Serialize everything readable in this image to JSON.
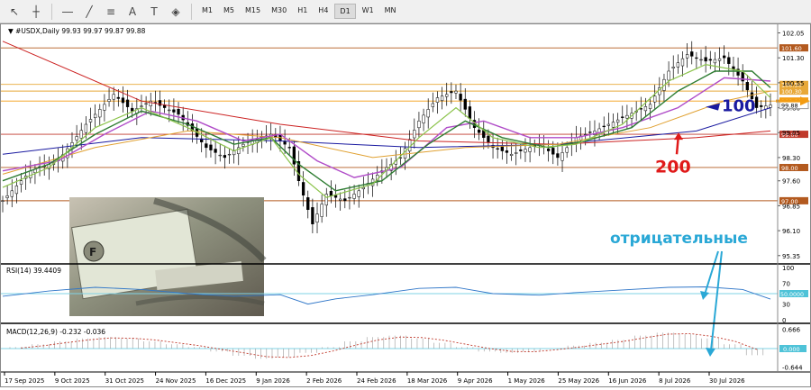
{
  "toolbar": {
    "tools": [
      "cursor-icon",
      "crosshair-icon",
      "horizontal-line-icon",
      "trendline-icon",
      "fibonacci-icon",
      "text-icon",
      "label-icon",
      "shapes-icon"
    ],
    "timeframes": [
      "M1",
      "M5",
      "M15",
      "M30",
      "H1",
      "H4",
      "D1",
      "W1",
      "MN"
    ],
    "active_timeframe": "D1"
  },
  "chart_data": {
    "type": "line",
    "header": "▼ #USDX,Daily  99.93 99.97 99.87 99.88",
    "price_ticks": [
      "102.05",
      "101.30",
      "100.55",
      "99.80",
      "99.05",
      "98.30",
      "97.60",
      "96.85",
      "96.10",
      "95.35"
    ],
    "hlines": [
      {
        "label": "101.60",
        "value": 101.6,
        "color": "#b35a1f"
      },
      {
        "label": "100.50",
        "value": 100.5,
        "color": "#e8a838"
      },
      {
        "label": "100.30",
        "value": 100.3,
        "color": "#e8a838"
      },
      {
        "label": "100.00",
        "value": 100.0,
        "color": "#f39c12"
      },
      {
        "label": "99.00",
        "value": 99.0,
        "color": "#c0392b"
      },
      {
        "label": "98.00",
        "value": 98.0,
        "color": "#b35a1f"
      },
      {
        "label": "97.00",
        "value": 97.0,
        "color": "#b35a1f"
      }
    ],
    "current_price_label": "99.88",
    "annotations": {
      "ma100": "100",
      "ma200": "200",
      "negative": "отрицательные"
    },
    "x_labels": [
      "17 Sep 2025",
      "9 Oct 2025",
      "31 Oct 2025",
      "24 Nov 2025",
      "16 Dec 2025",
      "9 Jan 2026",
      "2 Feb 2026",
      "24 Feb 2026",
      "18 Mar 2026",
      "9 Apr 2026",
      "1 May 2026",
      "25 May 2026",
      "16 Jun 2026",
      "8 Jul 2026",
      "30 Jul 2026"
    ],
    "close_path": [
      [
        0,
        97.0
      ],
      [
        6,
        97.9
      ],
      [
        12,
        98.2
      ],
      [
        18,
        99.3
      ],
      [
        24,
        100.2
      ],
      [
        28,
        99.7
      ],
      [
        32,
        100.0
      ],
      [
        38,
        99.6
      ],
      [
        44,
        98.6
      ],
      [
        48,
        98.3
      ],
      [
        52,
        98.7
      ],
      [
        58,
        99.0
      ],
      [
        62,
        98.6
      ],
      [
        64,
        97.6
      ],
      [
        67,
        96.3
      ],
      [
        70,
        97.2
      ],
      [
        74,
        97.0
      ],
      [
        78,
        97.4
      ],
      [
        82,
        97.9
      ],
      [
        86,
        98.3
      ],
      [
        90,
        99.4
      ],
      [
        94,
        100.1
      ],
      [
        98,
        100.3
      ],
      [
        102,
        99.2
      ],
      [
        106,
        98.6
      ],
      [
        110,
        98.4
      ],
      [
        116,
        98.7
      ],
      [
        120,
        98.3
      ],
      [
        124,
        98.9
      ],
      [
        128,
        99.1
      ],
      [
        134,
        99.5
      ],
      [
        140,
        99.9
      ],
      [
        144,
        100.9
      ],
      [
        148,
        101.4
      ],
      [
        152,
        101.2
      ],
      [
        156,
        101.3
      ],
      [
        160,
        100.6
      ],
      [
        163,
        99.8
      ],
      [
        166,
        99.88
      ]
    ],
    "ma_fast_path": [
      [
        0,
        97.4
      ],
      [
        10,
        98.0
      ],
      [
        20,
        99.2
      ],
      [
        30,
        99.8
      ],
      [
        40,
        99.2
      ],
      [
        50,
        98.5
      ],
      [
        58,
        98.9
      ],
      [
        64,
        97.8
      ],
      [
        70,
        97.1
      ],
      [
        80,
        97.5
      ],
      [
        90,
        98.9
      ],
      [
        98,
        99.8
      ],
      [
        106,
        98.9
      ],
      [
        116,
        98.6
      ],
      [
        124,
        98.7
      ],
      [
        134,
        99.3
      ],
      [
        144,
        100.6
      ],
      [
        152,
        101.1
      ],
      [
        160,
        100.9
      ],
      [
        166,
        100.1
      ]
    ],
    "ma_slow_path": [
      [
        0,
        97.6
      ],
      [
        10,
        98.1
      ],
      [
        20,
        99.0
      ],
      [
        30,
        99.7
      ],
      [
        40,
        99.3
      ],
      [
        50,
        98.7
      ],
      [
        58,
        98.9
      ],
      [
        64,
        98.1
      ],
      [
        72,
        97.3
      ],
      [
        82,
        97.6
      ],
      [
        92,
        98.7
      ],
      [
        100,
        99.4
      ],
      [
        108,
        98.9
      ],
      [
        118,
        98.6
      ],
      [
        126,
        98.8
      ],
      [
        136,
        99.2
      ],
      [
        146,
        100.3
      ],
      [
        154,
        100.9
      ],
      [
        162,
        100.9
      ],
      [
        166,
        100.4
      ]
    ],
    "ma_violet_path": [
      [
        0,
        97.9
      ],
      [
        12,
        98.2
      ],
      [
        22,
        99.0
      ],
      [
        32,
        99.7
      ],
      [
        42,
        99.4
      ],
      [
        52,
        98.8
      ],
      [
        60,
        99.0
      ],
      [
        68,
        98.2
      ],
      [
        76,
        97.7
      ],
      [
        86,
        98.0
      ],
      [
        96,
        99.2
      ],
      [
        104,
        99.4
      ],
      [
        114,
        98.9
      ],
      [
        124,
        98.9
      ],
      [
        134,
        99.2
      ],
      [
        146,
        99.8
      ],
      [
        156,
        100.7
      ],
      [
        166,
        100.6
      ]
    ],
    "ma100_path": [
      [
        0,
        98.4
      ],
      [
        30,
        98.9
      ],
      [
        60,
        98.8
      ],
      [
        90,
        98.6
      ],
      [
        120,
        98.7
      ],
      [
        150,
        99.1
      ],
      [
        166,
        99.8
      ]
    ],
    "ma200_path": [
      [
        0,
        101.8
      ],
      [
        30,
        100.0
      ],
      [
        60,
        99.3
      ],
      [
        90,
        98.8
      ],
      [
        120,
        98.7
      ],
      [
        150,
        98.9
      ],
      [
        166,
        99.1
      ]
    ],
    "ma_orange_path": [
      [
        0,
        97.8
      ],
      [
        20,
        98.6
      ],
      [
        40,
        99.1
      ],
      [
        60,
        98.9
      ],
      [
        80,
        98.3
      ],
      [
        100,
        98.6
      ],
      [
        120,
        98.7
      ],
      [
        140,
        99.2
      ],
      [
        156,
        100.0
      ],
      [
        166,
        100.3
      ]
    ],
    "rsi": {
      "header": "RSI(14) 39.4409",
      "ticks": [
        "100",
        "70",
        "50.0000",
        "30",
        "0"
      ],
      "path": [
        [
          0,
          45
        ],
        [
          10,
          55
        ],
        [
          20,
          62
        ],
        [
          30,
          58
        ],
        [
          40,
          50
        ],
        [
          50,
          45
        ],
        [
          60,
          48
        ],
        [
          66,
          30
        ],
        [
          72,
          40
        ],
        [
          80,
          48
        ],
        [
          90,
          60
        ],
        [
          98,
          62
        ],
        [
          106,
          50
        ],
        [
          116,
          47
        ],
        [
          124,
          52
        ],
        [
          134,
          57
        ],
        [
          144,
          62
        ],
        [
          152,
          63
        ],
        [
          160,
          58
        ],
        [
          166,
          39.44
        ]
      ]
    },
    "macd": {
      "header": "MACD(12,26,9) -0.232 -0.036",
      "ticks": [
        "0.666",
        "0.000",
        "-0.644"
      ],
      "hist": [
        0.05,
        0.15,
        0.25,
        0.35,
        0.4,
        0.35,
        0.25,
        0.15,
        0.05,
        -0.1,
        -0.25,
        -0.35,
        -0.3,
        -0.15,
        0.05,
        0.25,
        0.4,
        0.45,
        0.35,
        0.2,
        0.05,
        -0.1,
        -0.15,
        -0.1,
        0.0,
        0.1,
        0.2,
        0.3,
        0.45,
        0.55,
        0.5,
        0.35,
        0.15,
        -0.23
      ],
      "signal": [
        0.02,
        0.1,
        0.2,
        0.3,
        0.37,
        0.36,
        0.3,
        0.2,
        0.1,
        -0.03,
        -0.15,
        -0.28,
        -0.31,
        -0.24,
        -0.08,
        0.12,
        0.3,
        0.4,
        0.38,
        0.28,
        0.14,
        0.0,
        -0.1,
        -0.11,
        -0.04,
        0.05,
        0.15,
        0.25,
        0.38,
        0.5,
        0.52,
        0.42,
        0.25,
        -0.036
      ]
    }
  }
}
